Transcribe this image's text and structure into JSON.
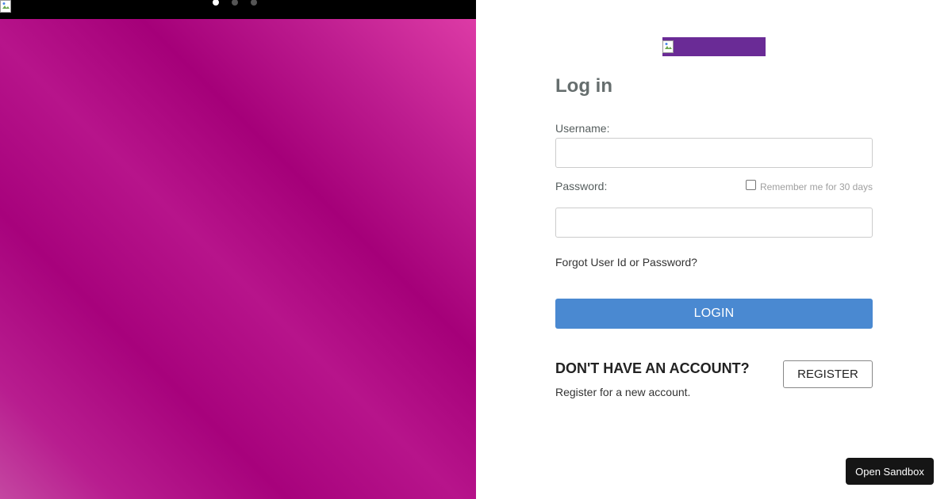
{
  "carousel": {
    "slide_count": 3,
    "active_index": 0
  },
  "login": {
    "title": "Log in",
    "username_label": "Username:",
    "username_value": "",
    "password_label": "Password:",
    "password_value": "",
    "remember_label": "Remember me for 30 days",
    "remember_checked": false,
    "forgot_link": "Forgot User Id or Password?",
    "login_button": "LOGIN"
  },
  "register": {
    "heading": "DON'T HAVE AN ACCOUNT?",
    "description": "Register for a new account.",
    "button": "REGISTER"
  },
  "sandbox": {
    "button": "Open Sandbox"
  },
  "colors": {
    "brand_purple": "#6a2b96",
    "login_blue": "#4a89d1",
    "slide_magenta": "#a7037c",
    "slide_pink": "#e040a9"
  },
  "icons": {
    "broken_image": "broken-image-icon"
  }
}
